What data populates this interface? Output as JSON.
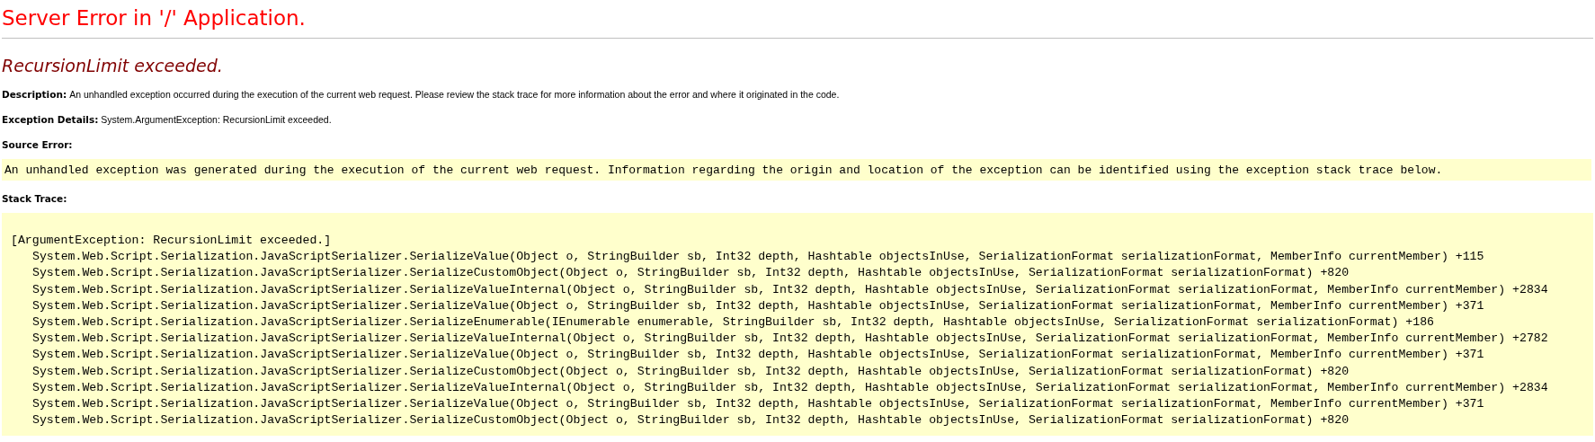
{
  "title": "Server Error in '/' Application.",
  "heading": "RecursionLimit exceeded.",
  "description": {
    "label": "Description:",
    "text": "An unhandled exception occurred during the execution of the current web request. Please review the stack trace for more information about the error and where it originated in the code."
  },
  "exception_details": {
    "label": "Exception Details:",
    "text": "System.ArgumentException: RecursionLimit exceeded."
  },
  "source_error": {
    "label": "Source Error:",
    "message": "An unhandled exception was generated during the execution of the current web request. Information regarding the origin and location of the exception can be identified using the exception stack trace below."
  },
  "stack_trace": {
    "label": "Stack Trace:",
    "lines": [
      {
        "kind": "exception",
        "text": "[ArgumentException: RecursionLimit exceeded.]"
      },
      {
        "kind": "frame",
        "text": "System.Web.Script.Serialization.JavaScriptSerializer.SerializeValue(Object o, StringBuilder sb, Int32 depth, Hashtable objectsInUse, SerializationFormat serializationFormat, MemberInfo currentMember) +115"
      },
      {
        "kind": "frame",
        "text": "System.Web.Script.Serialization.JavaScriptSerializer.SerializeCustomObject(Object o, StringBuilder sb, Int32 depth, Hashtable objectsInUse, SerializationFormat serializationFormat) +820"
      },
      {
        "kind": "frame",
        "text": "System.Web.Script.Serialization.JavaScriptSerializer.SerializeValueInternal(Object o, StringBuilder sb, Int32 depth, Hashtable objectsInUse, SerializationFormat serializationFormat, MemberInfo currentMember) +2834"
      },
      {
        "kind": "frame",
        "text": "System.Web.Script.Serialization.JavaScriptSerializer.SerializeValue(Object o, StringBuilder sb, Int32 depth, Hashtable objectsInUse, SerializationFormat serializationFormat, MemberInfo currentMember) +371"
      },
      {
        "kind": "frame",
        "text": "System.Web.Script.Serialization.JavaScriptSerializer.SerializeEnumerable(IEnumerable enumerable, StringBuilder sb, Int32 depth, Hashtable objectsInUse, SerializationFormat serializationFormat) +186"
      },
      {
        "kind": "frame",
        "text": "System.Web.Script.Serialization.JavaScriptSerializer.SerializeValueInternal(Object o, StringBuilder sb, Int32 depth, Hashtable objectsInUse, SerializationFormat serializationFormat, MemberInfo currentMember) +2782"
      },
      {
        "kind": "frame",
        "text": "System.Web.Script.Serialization.JavaScriptSerializer.SerializeValue(Object o, StringBuilder sb, Int32 depth, Hashtable objectsInUse, SerializationFormat serializationFormat, MemberInfo currentMember) +371"
      },
      {
        "kind": "frame",
        "text": "System.Web.Script.Serialization.JavaScriptSerializer.SerializeCustomObject(Object o, StringBuilder sb, Int32 depth, Hashtable objectsInUse, SerializationFormat serializationFormat) +820"
      },
      {
        "kind": "frame",
        "text": "System.Web.Script.Serialization.JavaScriptSerializer.SerializeValueInternal(Object o, StringBuilder sb, Int32 depth, Hashtable objectsInUse, SerializationFormat serializationFormat, MemberInfo currentMember) +2834"
      },
      {
        "kind": "frame",
        "text": "System.Web.Script.Serialization.JavaScriptSerializer.SerializeValue(Object o, StringBuilder sb, Int32 depth, Hashtable objectsInUse, SerializationFormat serializationFormat, MemberInfo currentMember) +371"
      },
      {
        "kind": "frame",
        "text": "System.Web.Script.Serialization.JavaScriptSerializer.SerializeCustomObject(Object o, StringBuilder sb, Int32 depth, Hashtable objectsInUse, SerializationFormat serializationFormat) +820"
      }
    ]
  }
}
